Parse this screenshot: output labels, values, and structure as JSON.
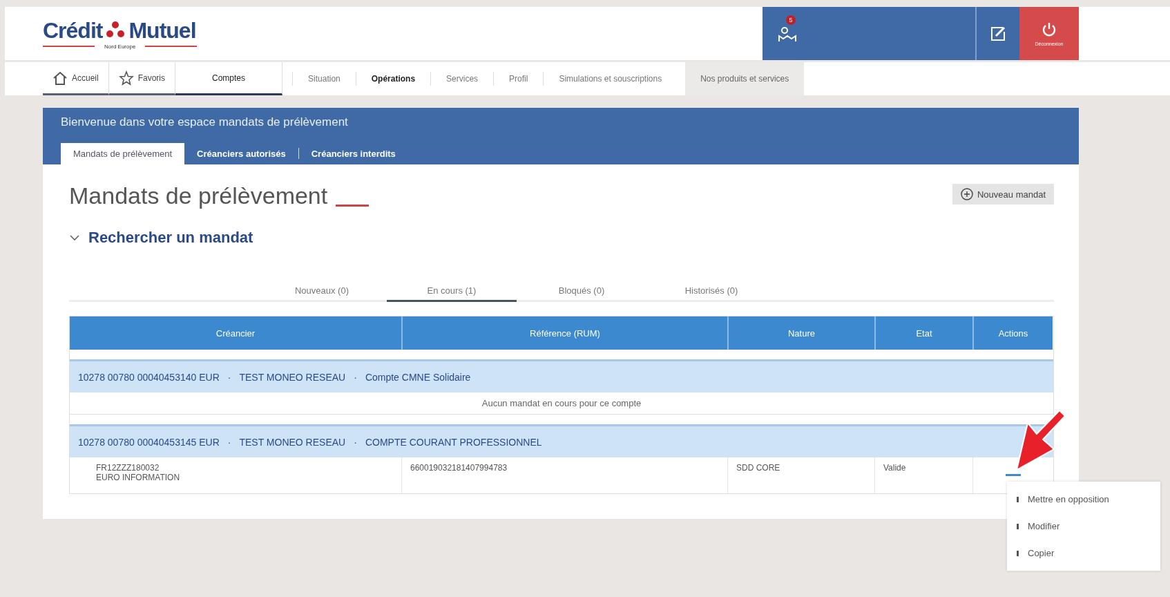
{
  "header": {
    "logo": {
      "name": "Crédit",
      "name2": "Mutuel",
      "subtitle": "Nord Europe"
    },
    "notification_count": "5",
    "logout": "Déconnexion"
  },
  "nav": {
    "items": [
      {
        "label": "Accueil",
        "kind": "home",
        "selected": false
      },
      {
        "label": "Favoris",
        "kind": "star",
        "selected": false
      },
      {
        "label": "Comptes",
        "kind": "plain",
        "selected": true
      }
    ],
    "menu": [
      {
        "label": "Situation",
        "bold": false
      },
      {
        "label": "Opérations",
        "bold": true
      },
      {
        "label": "Services",
        "bold": false
      },
      {
        "label": "Profil",
        "bold": false
      },
      {
        "label": "Simulations et souscriptions",
        "bold": false
      }
    ],
    "products": "Nos produits et services"
  },
  "banner": {
    "title": "Bienvenue dans votre espace mandats de prélèvement",
    "tabs": [
      {
        "label": "Mandats de prélèvement",
        "selected": true
      },
      {
        "label": "Créanciers autorisés",
        "selected": false
      },
      {
        "label": "Créanciers interdits",
        "selected": false
      }
    ]
  },
  "page": {
    "title": "Mandats de prélèvement",
    "new_button": "Nouveau mandat",
    "search": {
      "label": "Rechercher un mandat",
      "expanded": false
    }
  },
  "status_tabs": [
    {
      "label": "Nouveaux (0)",
      "selected": false
    },
    {
      "label": "En cours (1)",
      "selected": true
    },
    {
      "label": "Bloqués (0)",
      "selected": false
    },
    {
      "label": "Historisés (0)",
      "selected": false
    }
  ],
  "table": {
    "columns": [
      "Créancier",
      "Référence (RUM)",
      "Nature",
      "Etat",
      "Actions"
    ],
    "groups": [
      {
        "account": "10278 00780 00040453140 EUR",
        "holder": "TEST MONEO RESEAU",
        "label": "Compte CMNE Solidaire",
        "separator": "·",
        "empty": "Aucun mandat en cours pour ce compte"
      },
      {
        "account": "10278 00780 00040453145 EUR",
        "holder": "TEST MONEO RESEAU",
        "label": "COMPTE COURANT PROFESSIONNEL",
        "separator": "·",
        "rows": [
          {
            "creditor_id": "FR12ZZZ180032",
            "creditor": "EURO INFORMATION",
            "reference": "660019032181407994783",
            "nature": "SDD CORE",
            "state": "Valide"
          }
        ]
      }
    ]
  },
  "action_menu": [
    "Mettre en opposition",
    "Modifier",
    "Copier"
  ]
}
